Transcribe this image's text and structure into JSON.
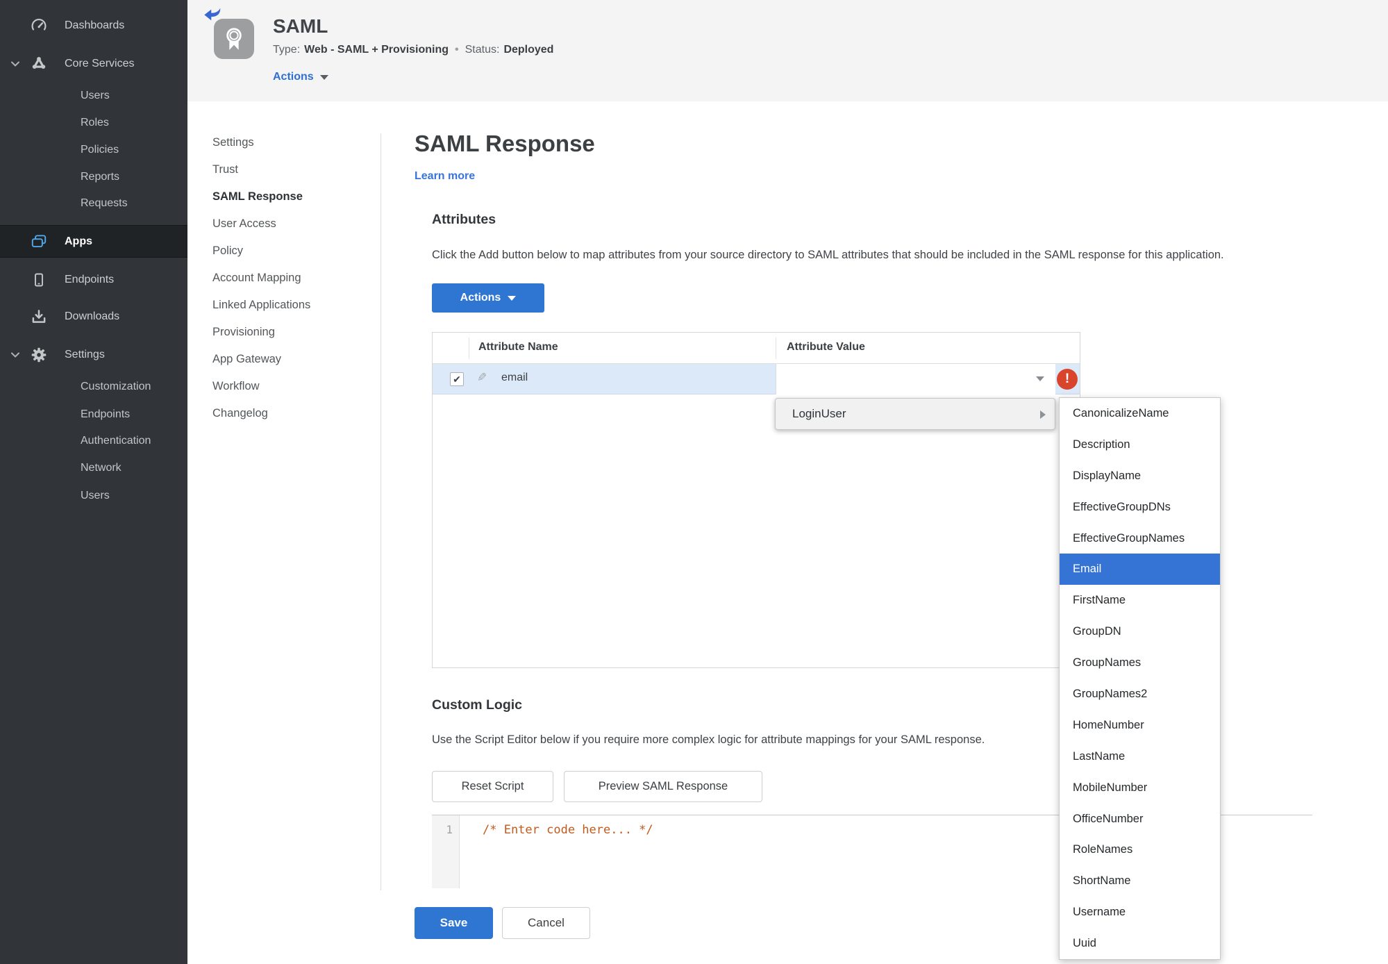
{
  "colors": {
    "accent_blue": "#2e76d2",
    "selected_row_blue": "#dce9f8",
    "menu_selected_blue": "#3574d4",
    "status_green": "#428a28",
    "error_red": "#d9452c",
    "code_comment_orange": "#c05a1e",
    "sidebar_bg": "#313539",
    "sidebar_app_icon_blue": "#4fa8e8",
    "header_bg": "#f4f4f5"
  },
  "icons": {
    "back_arrow": "back-arrow-icon",
    "app_badge": "award-ribbon-icon",
    "dashboards": "gauge-icon",
    "core_services": "nodes-triangle-icon",
    "apps": "stacked-windows-icon",
    "endpoints": "mobile-device-icon",
    "downloads": "download-tray-icon",
    "settings": "gear-icon",
    "chevron": "chevron-down-icon",
    "pencil_glyph": "✎",
    "check_glyph": "✔",
    "error_glyph": "!"
  },
  "sidebar": {
    "items": [
      {
        "label": "Dashboards"
      },
      {
        "label": "Core Services"
      },
      {
        "label": "Users"
      },
      {
        "label": "Roles"
      },
      {
        "label": "Policies"
      },
      {
        "label": "Reports"
      },
      {
        "label": "Requests"
      },
      {
        "label": "Apps"
      },
      {
        "label": "Endpoints"
      },
      {
        "label": "Downloads"
      },
      {
        "label": "Settings"
      },
      {
        "label": "Customization"
      },
      {
        "label": "Endpoints"
      },
      {
        "label": "Authentication"
      },
      {
        "label": "Network"
      },
      {
        "label": "Users"
      }
    ],
    "active": "Apps"
  },
  "header": {
    "title": "SAML",
    "type_label": "Type:",
    "type_value": "Web - SAML + Provisioning",
    "separator": "•",
    "status_label": "Status:",
    "status_value": "Deployed",
    "actions_label": "Actions"
  },
  "subnav": {
    "items": [
      {
        "label": "Settings"
      },
      {
        "label": "Trust"
      },
      {
        "label": "SAML Response"
      },
      {
        "label": "User Access"
      },
      {
        "label": "Policy"
      },
      {
        "label": "Account Mapping"
      },
      {
        "label": "Linked Applications"
      },
      {
        "label": "Provisioning"
      },
      {
        "label": "App Gateway"
      },
      {
        "label": "Workflow"
      },
      {
        "label": "Changelog"
      }
    ],
    "active": "SAML Response"
  },
  "main": {
    "page_title": "SAML Response",
    "learn_more": "Learn more",
    "attributes": {
      "heading": "Attributes",
      "description": "Click the Add button below to map attributes from your source directory to SAML attributes that should be included in the SAML response for this application.",
      "actions_button": "Actions",
      "table": {
        "col_name": "Attribute Name",
        "col_value": "Attribute Value",
        "row": {
          "name": "email",
          "checked": true,
          "value": ""
        }
      }
    },
    "dropdown": {
      "parent_item": "LoginUser",
      "selected": "Email",
      "items": [
        "CanonicalizeName",
        "Description",
        "DisplayName",
        "EffectiveGroupDNs",
        "EffectiveGroupNames",
        "Email",
        "FirstName",
        "GroupDN",
        "GroupNames",
        "GroupNames2",
        "HomeNumber",
        "LastName",
        "MobileNumber",
        "OfficeNumber",
        "RoleNames",
        "ShortName",
        "Username",
        "Uuid"
      ]
    },
    "custom_logic": {
      "heading": "Custom Logic",
      "description": "Use the Script Editor below if you require more complex logic for attribute mappings for your SAML response.",
      "reset_button": "Reset Script",
      "preview_button": "Preview SAML Response",
      "editor": {
        "line_number": "1",
        "code": "/* Enter code here... */"
      }
    },
    "save_button": "Save",
    "cancel_button": "Cancel"
  }
}
